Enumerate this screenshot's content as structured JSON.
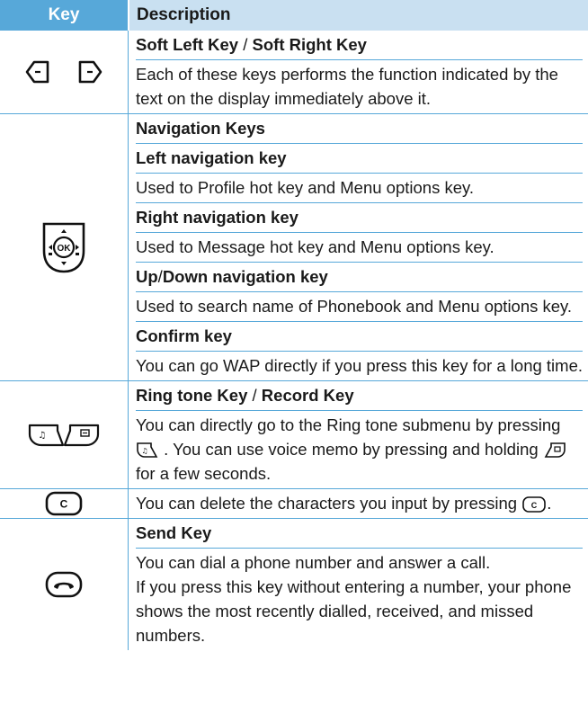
{
  "header": {
    "key": "Key",
    "description": "Description"
  },
  "rows": [
    {
      "icon": "soft-keys-icon",
      "title_parts": [
        "Soft Left Key",
        " / ",
        "Soft Right Key"
      ],
      "text": "Each of these keys performs the function indicated by the text on the display immediately above it."
    },
    {
      "icon": "navigation-ok-key-icon",
      "title": "Navigation Keys",
      "sections": [
        {
          "title": "Left navigation key",
          "text": "Used to Profile hot key and Menu options key."
        },
        {
          "title": "Right navigation key",
          "text": "Used to Message hot key and Menu options key."
        },
        {
          "title_parts": [
            "Up",
            "/",
            "Down navigation key"
          ],
          "text": "Used to search name of Phonebook and Menu options key."
        },
        {
          "title": "Confirm key",
          "text": "You can go WAP directly if you press this key for a long time."
        }
      ]
    },
    {
      "icon": "ringtone-record-keys-icon",
      "title_parts": [
        "Ring tone Key",
        " / ",
        "Record Key"
      ],
      "text_a": "You can directly go to the Ring tone submenu by pressing",
      "text_b": ". You can use voice memo by pressing and holding",
      "text_c": "for a few seconds."
    },
    {
      "icon": "clear-key-icon",
      "key_letter": "C",
      "text_a": "You can delete the characters you input by pressing",
      "text_b": "."
    },
    {
      "icon": "send-key-icon",
      "title": "Send Key",
      "text_1": "You can dial a phone number and answer a call.",
      "text_2": "If you press this key without entering a number, your phone shows the most recently dialled, received, and missed numbers."
    }
  ]
}
